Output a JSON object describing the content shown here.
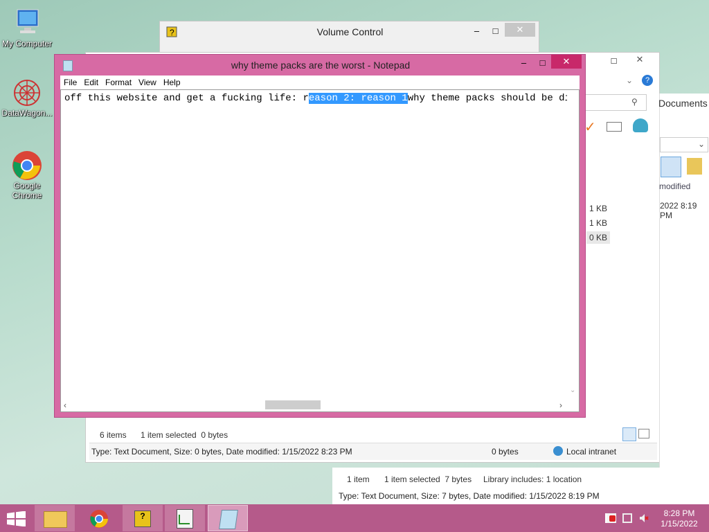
{
  "desktop": {
    "icons": [
      {
        "label": "My Computer"
      },
      {
        "label": "DataWagon..."
      },
      {
        "label": "Google Chrome"
      }
    ]
  },
  "volume_control": {
    "title": "Volume Control"
  },
  "explorer_back": {
    "sizes": [
      "1 KB",
      "1 KB",
      "0 KB"
    ],
    "status_items": "6 items",
    "status_selected": "1 item selected  0 bytes",
    "details": "Type: Text Document, Size: 0 bytes, Date modified: 1/15/2022 8:23 PM",
    "details_size": "0 bytes",
    "zone": "Local intranet"
  },
  "explorer_front": {
    "title_fragment": "Documents",
    "column_label": "modified",
    "date_cell": "2022 8:19 PM",
    "status_items": "1 item",
    "status_selected": "1 item selected  7 bytes",
    "library": "Library includes: 1 location",
    "details": "Type: Text Document, Size: 7 bytes, Date modified: 1/15/2022 8:19 PM"
  },
  "notepad": {
    "title": "why theme packs are the worst - Notepad",
    "menu": [
      "File",
      "Edit",
      "Format",
      "View",
      "Help"
    ],
    "text_before": "off this website and get a fucking life: r",
    "text_selected": "eason 2: reason 1",
    "text_after": "why theme packs should be disabl"
  },
  "taskbar": {
    "time": "8:28 PM",
    "date": "1/15/2022"
  },
  "colors": {
    "accent": "#d76aa4",
    "taskbar": "#b55a8a",
    "selection": "#3399ff"
  }
}
